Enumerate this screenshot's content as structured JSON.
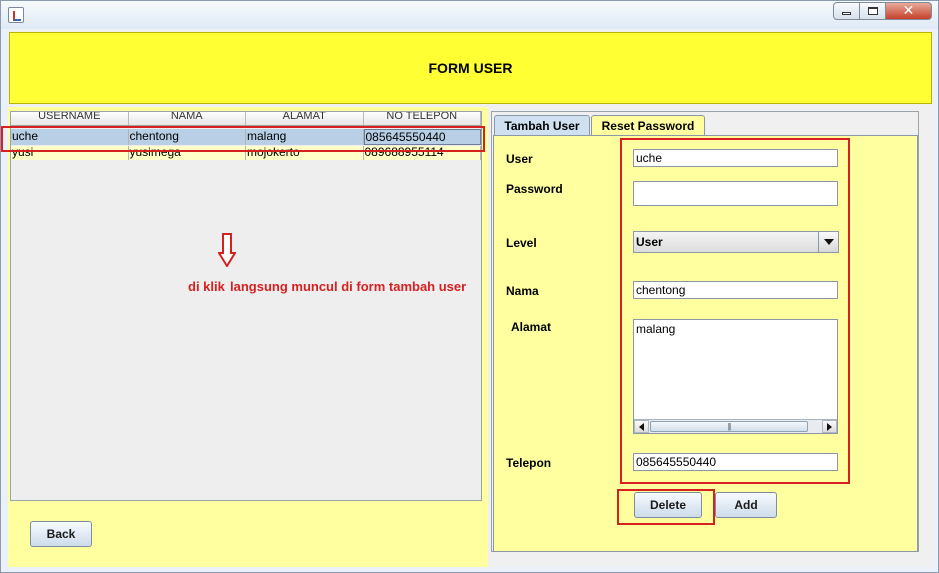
{
  "window": {
    "buttons": {
      "minimize": "minimize-icon",
      "maximize": "maximize-icon",
      "close": "close-icon"
    }
  },
  "header": {
    "title": "FORM USER",
    "color": "#ffff33"
  },
  "table": {
    "columns": [
      "USERNAME",
      "NAMA",
      "ALAMAT",
      "NO TELEPON"
    ],
    "rows": [
      [
        "uche",
        "chentong",
        "malang",
        "085645550440"
      ],
      [
        "yusi",
        "yusimega",
        "mojokerto",
        "089688955114"
      ]
    ],
    "selected_row": 0
  },
  "annotation": {
    "text1": "di klik",
    "text2": "langsung muncul di form tambah user",
    "color": "#d72020"
  },
  "left_buttons": {
    "back": "Back"
  },
  "tabs": [
    {
      "label": "Tambah User",
      "active": true
    },
    {
      "label": "Reset Password",
      "active": false
    }
  ],
  "form": {
    "user_label": "User",
    "user_value": "uche",
    "password_label": "Password",
    "password_value": "",
    "level_label": "Level",
    "level_value": "User",
    "nama_label": "Nama",
    "nama_value": "chentong",
    "alamat_label": "Alamat",
    "alamat_value": "malang",
    "telepon_label": "Telepon",
    "telepon_value": "085645550440"
  },
  "form_buttons": {
    "delete": "Delete",
    "add": "Add"
  },
  "colors": {
    "panel_yellow": "#ffffa0",
    "selection": "#b8cfe5"
  }
}
